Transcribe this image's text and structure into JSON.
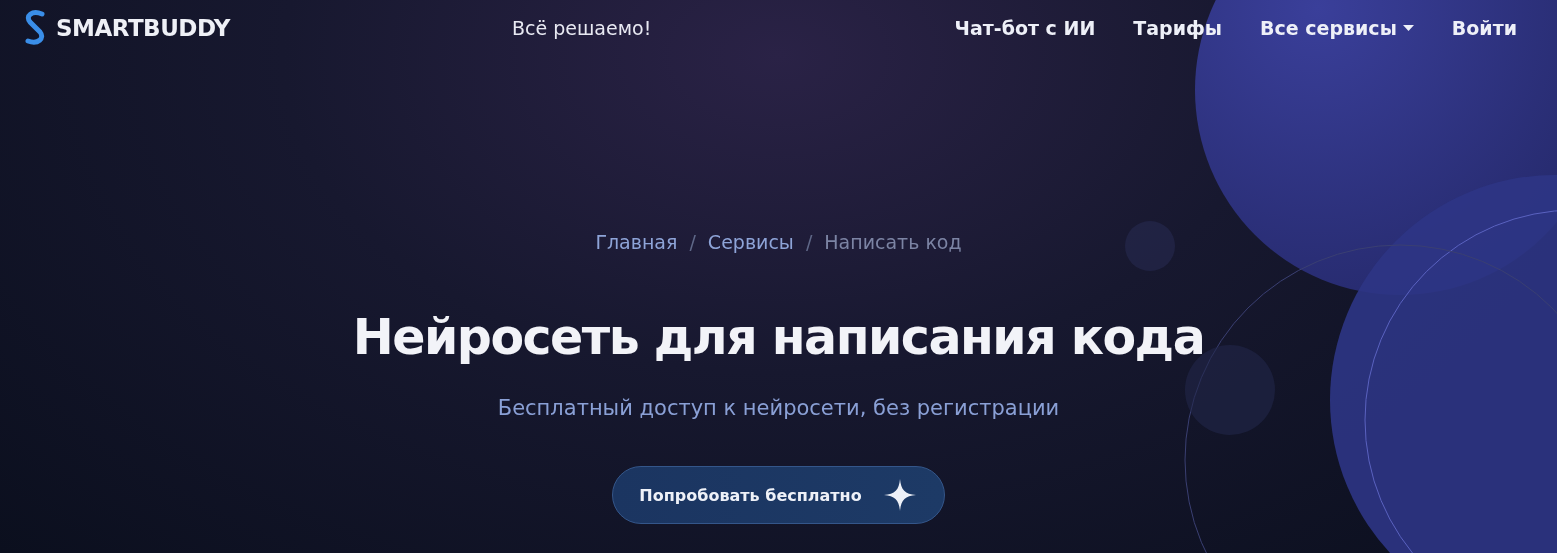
{
  "header": {
    "logo": "SMARTBUDDY",
    "tagline": "Всё решаемо!",
    "nav": [
      {
        "label": "Чат-бот с ИИ",
        "kind": "link"
      },
      {
        "label": "Тарифы",
        "kind": "link"
      },
      {
        "label": "Все сервисы",
        "kind": "dropdown"
      },
      {
        "label": "Войти",
        "kind": "link"
      }
    ]
  },
  "breadcrumb_separator": "/",
  "breadcrumbs": [
    {
      "label": "Главная",
      "kind": "link"
    },
    {
      "label": "Сервисы",
      "kind": "link"
    },
    {
      "label": "Написать код",
      "kind": "current"
    }
  ],
  "hero": {
    "title": "Нейросеть для написания кода",
    "subtitle": "Бесплатный доступ к нейросети, без регистрации",
    "button": "Попробовать бесплатно"
  }
}
